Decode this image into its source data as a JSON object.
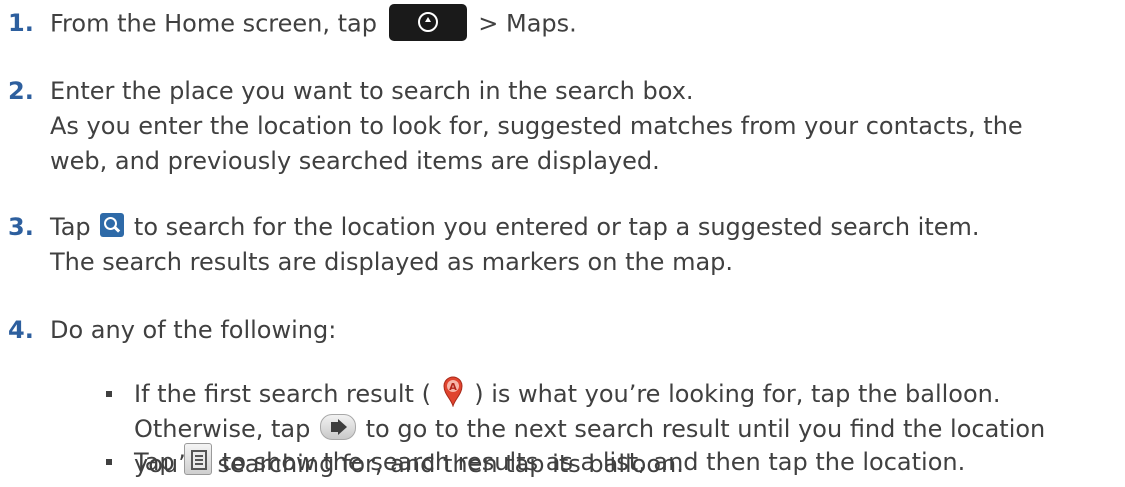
{
  "steps": [
    {
      "number": "1.",
      "part_a": "From the Home screen, tap",
      "part_b": "> Maps."
    },
    {
      "number": "2.",
      "line1": "Enter the place you want to search in the search box.",
      "line2": "As you enter the location to look for, suggested matches from your contacts, the",
      "line3": "web, and previously searched items are displayed."
    },
    {
      "number": "3.",
      "part_a": "Tap",
      "part_b": "to search for the location you entered or tap a suggested search item.",
      "line2": "The search results are displayed as markers on the map."
    },
    {
      "number": "4.",
      "line1": "Do any of the following:"
    }
  ],
  "bullets": [
    {
      "part_a": "If the first search result (",
      "part_b": ") is what you’re looking for, tap the balloon.",
      "line2_a": "Otherwise, tap",
      "line2_b": "to go to the next search result until you find the location",
      "line3": "you’re searching for, and then tap its balloon."
    },
    {
      "part_a": "Tap",
      "part_b": "to show the search results as a list, and then tap the location."
    }
  ],
  "icons": {
    "home": "all-apps-button-icon",
    "search": "search-icon",
    "marker": "map-marker-a-icon",
    "next": "next-arrow-icon",
    "list": "list-view-icon"
  },
  "marker_letter": "A",
  "colors": {
    "step_number": "#2d5f9e",
    "text": "#404040",
    "search_icon": "#2e6aa8",
    "marker": "#e0442f"
  }
}
